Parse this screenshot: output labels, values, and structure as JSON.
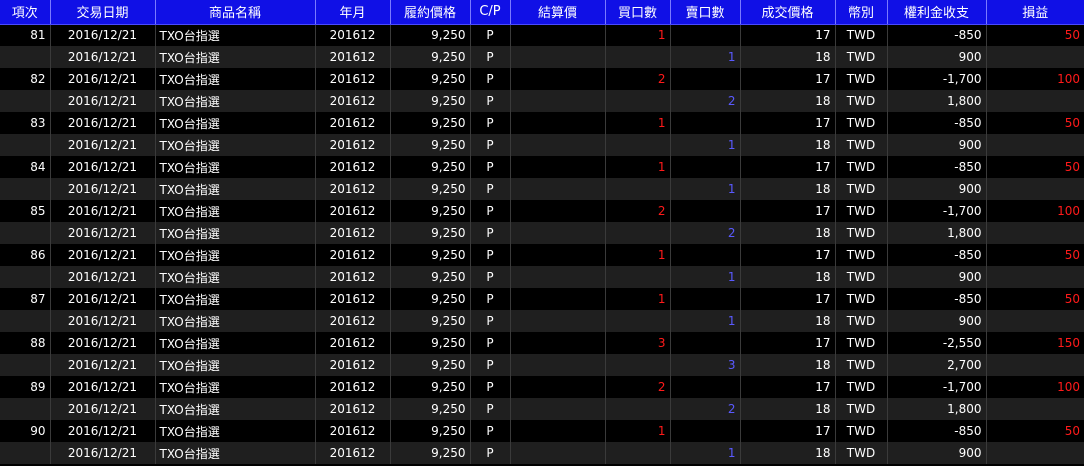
{
  "headers": [
    "項次",
    "交易日期",
    "商品名稱",
    "年月",
    "履約價格",
    "C/P",
    "結算價",
    "買口數",
    "賣口數",
    "成交價格",
    "幣別",
    "權利金收支",
    "損益"
  ],
  "rows": [
    {
      "item": "81",
      "date": "2016/12/21",
      "product": "TXO台指選",
      "ym": "201612",
      "strike": "9,250",
      "cp": "P",
      "settle": "",
      "buy": "1",
      "sell": "",
      "price": "17",
      "cur": "TWD",
      "premium": "-850",
      "pnl": "50"
    },
    {
      "item": "",
      "date": "2016/12/21",
      "product": "TXO台指選",
      "ym": "201612",
      "strike": "9,250",
      "cp": "P",
      "settle": "",
      "buy": "",
      "sell": "1",
      "price": "18",
      "cur": "TWD",
      "premium": "900",
      "pnl": ""
    },
    {
      "item": "82",
      "date": "2016/12/21",
      "product": "TXO台指選",
      "ym": "201612",
      "strike": "9,250",
      "cp": "P",
      "settle": "",
      "buy": "2",
      "sell": "",
      "price": "17",
      "cur": "TWD",
      "premium": "-1,700",
      "pnl": "100"
    },
    {
      "item": "",
      "date": "2016/12/21",
      "product": "TXO台指選",
      "ym": "201612",
      "strike": "9,250",
      "cp": "P",
      "settle": "",
      "buy": "",
      "sell": "2",
      "price": "18",
      "cur": "TWD",
      "premium": "1,800",
      "pnl": ""
    },
    {
      "item": "83",
      "date": "2016/12/21",
      "product": "TXO台指選",
      "ym": "201612",
      "strike": "9,250",
      "cp": "P",
      "settle": "",
      "buy": "1",
      "sell": "",
      "price": "17",
      "cur": "TWD",
      "premium": "-850",
      "pnl": "50"
    },
    {
      "item": "",
      "date": "2016/12/21",
      "product": "TXO台指選",
      "ym": "201612",
      "strike": "9,250",
      "cp": "P",
      "settle": "",
      "buy": "",
      "sell": "1",
      "price": "18",
      "cur": "TWD",
      "premium": "900",
      "pnl": ""
    },
    {
      "item": "84",
      "date": "2016/12/21",
      "product": "TXO台指選",
      "ym": "201612",
      "strike": "9,250",
      "cp": "P",
      "settle": "",
      "buy": "1",
      "sell": "",
      "price": "17",
      "cur": "TWD",
      "premium": "-850",
      "pnl": "50"
    },
    {
      "item": "",
      "date": "2016/12/21",
      "product": "TXO台指選",
      "ym": "201612",
      "strike": "9,250",
      "cp": "P",
      "settle": "",
      "buy": "",
      "sell": "1",
      "price": "18",
      "cur": "TWD",
      "premium": "900",
      "pnl": ""
    },
    {
      "item": "85",
      "date": "2016/12/21",
      "product": "TXO台指選",
      "ym": "201612",
      "strike": "9,250",
      "cp": "P",
      "settle": "",
      "buy": "2",
      "sell": "",
      "price": "17",
      "cur": "TWD",
      "premium": "-1,700",
      "pnl": "100"
    },
    {
      "item": "",
      "date": "2016/12/21",
      "product": "TXO台指選",
      "ym": "201612",
      "strike": "9,250",
      "cp": "P",
      "settle": "",
      "buy": "",
      "sell": "2",
      "price": "18",
      "cur": "TWD",
      "premium": "1,800",
      "pnl": ""
    },
    {
      "item": "86",
      "date": "2016/12/21",
      "product": "TXO台指選",
      "ym": "201612",
      "strike": "9,250",
      "cp": "P",
      "settle": "",
      "buy": "1",
      "sell": "",
      "price": "17",
      "cur": "TWD",
      "premium": "-850",
      "pnl": "50"
    },
    {
      "item": "",
      "date": "2016/12/21",
      "product": "TXO台指選",
      "ym": "201612",
      "strike": "9,250",
      "cp": "P",
      "settle": "",
      "buy": "",
      "sell": "1",
      "price": "18",
      "cur": "TWD",
      "premium": "900",
      "pnl": ""
    },
    {
      "item": "87",
      "date": "2016/12/21",
      "product": "TXO台指選",
      "ym": "201612",
      "strike": "9,250",
      "cp": "P",
      "settle": "",
      "buy": "1",
      "sell": "",
      "price": "17",
      "cur": "TWD",
      "premium": "-850",
      "pnl": "50"
    },
    {
      "item": "",
      "date": "2016/12/21",
      "product": "TXO台指選",
      "ym": "201612",
      "strike": "9,250",
      "cp": "P",
      "settle": "",
      "buy": "",
      "sell": "1",
      "price": "18",
      "cur": "TWD",
      "premium": "900",
      "pnl": ""
    },
    {
      "item": "88",
      "date": "2016/12/21",
      "product": "TXO台指選",
      "ym": "201612",
      "strike": "9,250",
      "cp": "P",
      "settle": "",
      "buy": "3",
      "sell": "",
      "price": "17",
      "cur": "TWD",
      "premium": "-2,550",
      "pnl": "150"
    },
    {
      "item": "",
      "date": "2016/12/21",
      "product": "TXO台指選",
      "ym": "201612",
      "strike": "9,250",
      "cp": "P",
      "settle": "",
      "buy": "",
      "sell": "3",
      "price": "18",
      "cur": "TWD",
      "premium": "2,700",
      "pnl": ""
    },
    {
      "item": "89",
      "date": "2016/12/21",
      "product": "TXO台指選",
      "ym": "201612",
      "strike": "9,250",
      "cp": "P",
      "settle": "",
      "buy": "2",
      "sell": "",
      "price": "17",
      "cur": "TWD",
      "premium": "-1,700",
      "pnl": "100"
    },
    {
      "item": "",
      "date": "2016/12/21",
      "product": "TXO台指選",
      "ym": "201612",
      "strike": "9,250",
      "cp": "P",
      "settle": "",
      "buy": "",
      "sell": "2",
      "price": "18",
      "cur": "TWD",
      "premium": "1,800",
      "pnl": ""
    },
    {
      "item": "90",
      "date": "2016/12/21",
      "product": "TXO台指選",
      "ym": "201612",
      "strike": "9,250",
      "cp": "P",
      "settle": "",
      "buy": "1",
      "sell": "",
      "price": "17",
      "cur": "TWD",
      "premium": "-850",
      "pnl": "50"
    },
    {
      "item": "",
      "date": "2016/12/21",
      "product": "TXO台指選",
      "ym": "201612",
      "strike": "9,250",
      "cp": "P",
      "settle": "",
      "buy": "",
      "sell": "1",
      "price": "18",
      "cur": "TWD",
      "premium": "900",
      "pnl": ""
    }
  ],
  "colors": {
    "header_bg": "#1010e6",
    "buy_color": "#ff1a1a",
    "sell_color": "#5a5aff",
    "pnl_color": "#ff1a1a"
  }
}
